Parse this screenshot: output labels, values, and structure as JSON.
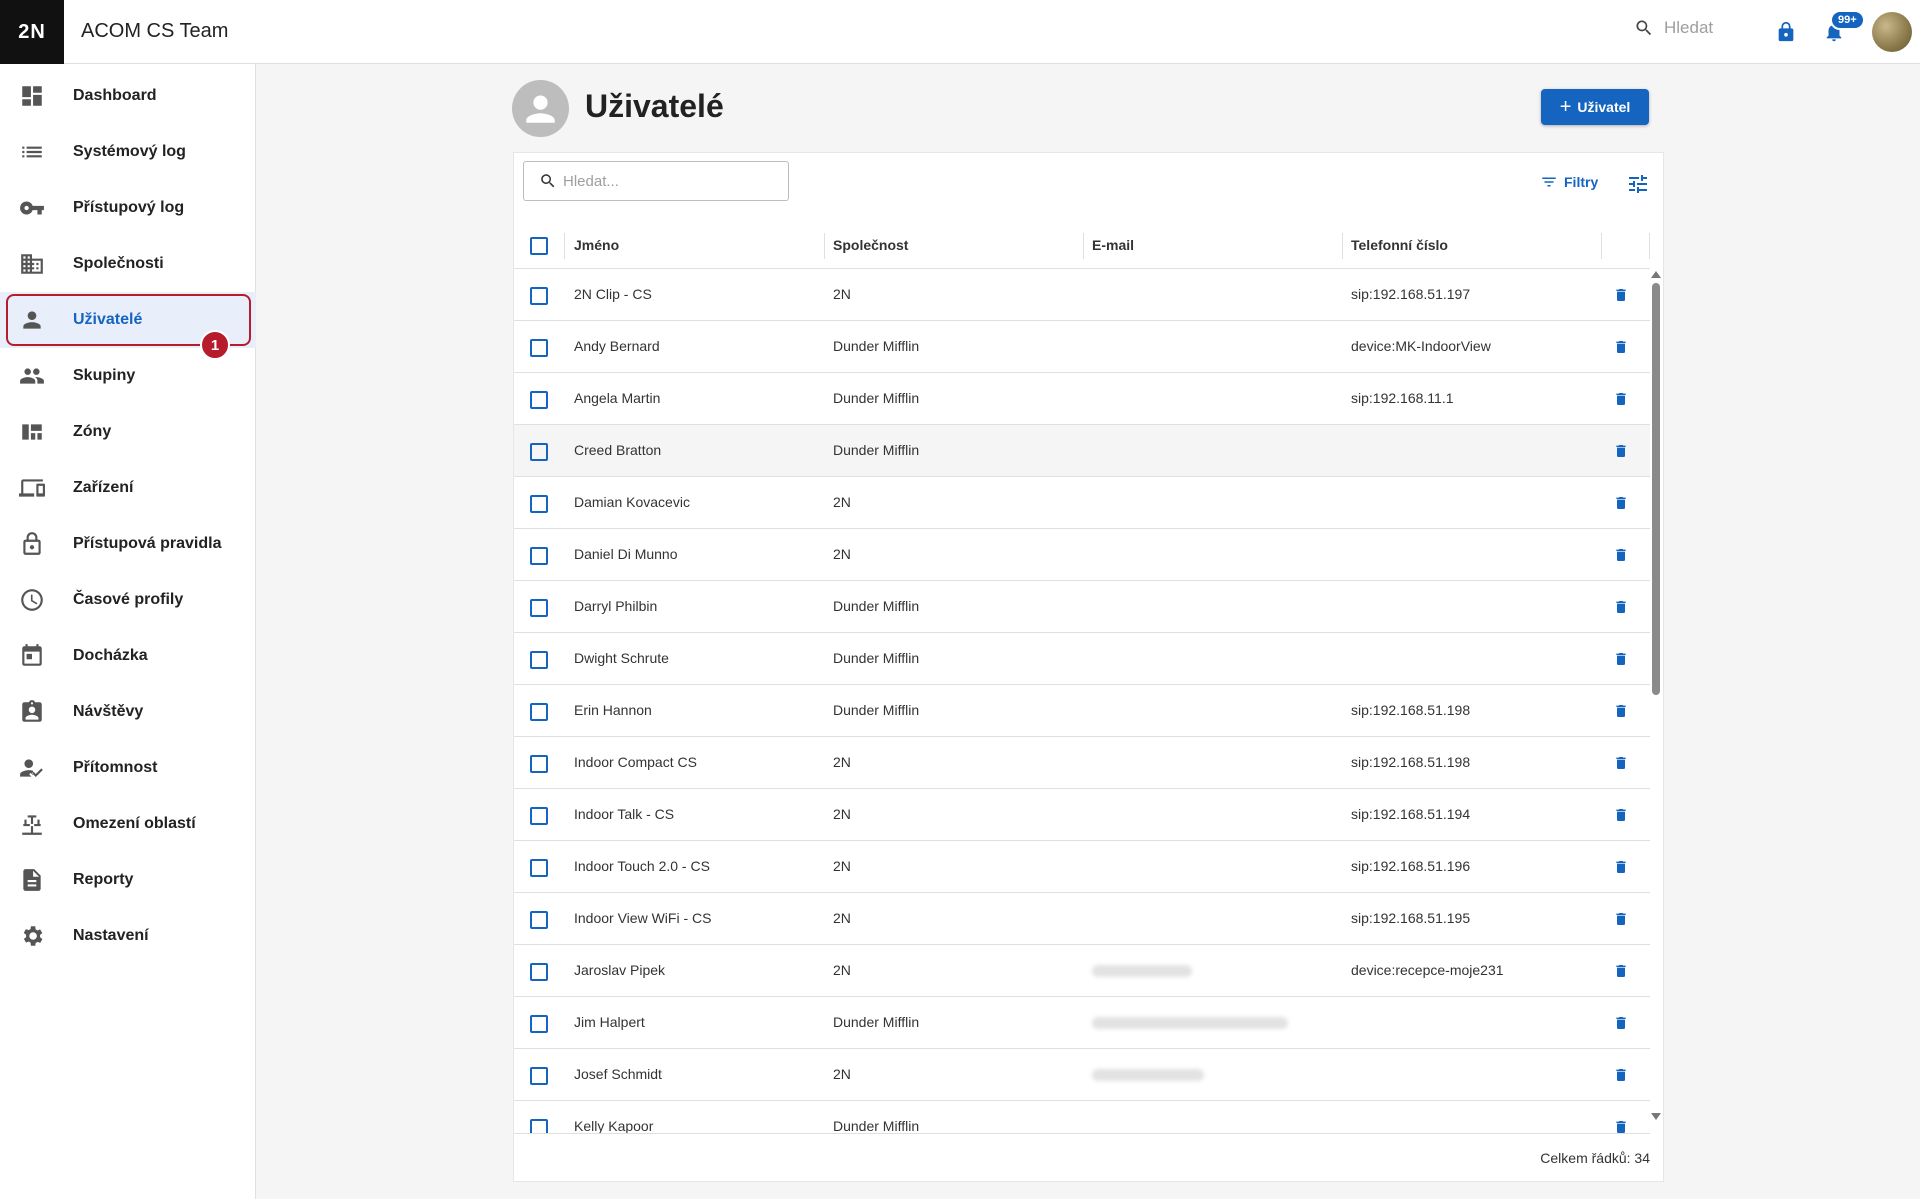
{
  "header": {
    "logo": "2N",
    "app_title": "ACOM CS Team",
    "search_placeholder": "Hledat",
    "notifications_badge": "99+"
  },
  "sidebar": {
    "items": [
      {
        "label": "Dashboard",
        "icon": "dashboard-icon"
      },
      {
        "label": "Systémový log",
        "icon": "list-icon"
      },
      {
        "label": "Přístupový log",
        "icon": "key-icon"
      },
      {
        "label": "Společnosti",
        "icon": "building-icon"
      },
      {
        "label": "Uživatelé",
        "icon": "person-icon",
        "active": true
      },
      {
        "label": "Skupiny",
        "icon": "group-icon"
      },
      {
        "label": "Zóny",
        "icon": "zones-icon"
      },
      {
        "label": "Zařízení",
        "icon": "devices-icon"
      },
      {
        "label": "Přístupová pravidla",
        "icon": "lock-open-icon"
      },
      {
        "label": "Časové profily",
        "icon": "clock-icon"
      },
      {
        "label": "Docházka",
        "icon": "calendar-icon"
      },
      {
        "label": "Návštěvy",
        "icon": "badge-icon"
      },
      {
        "label": "Přítomnost",
        "icon": "person-check-icon"
      },
      {
        "label": "Omezení oblastí",
        "icon": "area-restriction-icon"
      },
      {
        "label": "Reporty",
        "icon": "report-icon"
      },
      {
        "label": "Nastavení",
        "icon": "gear-icon"
      }
    ],
    "step_marker": "1"
  },
  "page": {
    "title": "Uživatelé",
    "add_button": "Uživatel",
    "search_placeholder": "Hledat...",
    "filters_label": "Filtry"
  },
  "table": {
    "columns": {
      "name": "Jméno",
      "company": "Společnost",
      "email": "E-mail",
      "phone": "Telefonní číslo"
    },
    "rows": [
      {
        "name": "2N Clip - CS",
        "company": "2N",
        "email": "",
        "phone": "sip:192.168.51.197"
      },
      {
        "name": "Andy Bernard",
        "company": "Dunder Mifflin",
        "email": "",
        "phone": "device:MK-IndoorView"
      },
      {
        "name": "Angela Martin",
        "company": "Dunder Mifflin",
        "email": "",
        "phone": "sip:192.168.11.1"
      },
      {
        "name": "Creed Bratton",
        "company": "Dunder Mifflin",
        "email": "",
        "phone": ""
      },
      {
        "name": "Damian Kovacevic",
        "company": "2N",
        "email": "",
        "phone": ""
      },
      {
        "name": "Daniel Di Munno",
        "company": "2N",
        "email": "",
        "phone": ""
      },
      {
        "name": "Darryl Philbin",
        "company": "Dunder Mifflin",
        "email": "",
        "phone": ""
      },
      {
        "name": "Dwight Schrute",
        "company": "Dunder Mifflin",
        "email": "",
        "phone": ""
      },
      {
        "name": "Erin Hannon",
        "company": "Dunder Mifflin",
        "email": "",
        "phone": "sip:192.168.51.198"
      },
      {
        "name": "Indoor Compact CS",
        "company": "2N",
        "email": "",
        "phone": "sip:192.168.51.198"
      },
      {
        "name": "Indoor Talk - CS",
        "company": "2N",
        "email": "",
        "phone": "sip:192.168.51.194"
      },
      {
        "name": "Indoor Touch 2.0 - CS",
        "company": "2N",
        "email": "",
        "phone": "sip:192.168.51.196"
      },
      {
        "name": "Indoor View WiFi - CS",
        "company": "2N",
        "email": "",
        "phone": "sip:192.168.51.195"
      },
      {
        "name": "Jaroslav Pipek",
        "company": "2N",
        "email": "",
        "email_blurred": true,
        "phone": "device:recepce-moje231"
      },
      {
        "name": "Jim Halpert",
        "company": "Dunder Mifflin",
        "email": "",
        "email_blurred": true,
        "phone": ""
      },
      {
        "name": "Josef Schmidt",
        "company": "2N",
        "email": "",
        "email_blurred": true,
        "phone": ""
      },
      {
        "name": "Kelly Kapoor",
        "company": "Dunder Mifflin",
        "email": "",
        "phone": ""
      }
    ],
    "footer": "Celkem řádků: 34"
  },
  "colors": {
    "accent": "#1565c0",
    "marker": "#b71c2c",
    "active_bg": "#e8eefa"
  }
}
